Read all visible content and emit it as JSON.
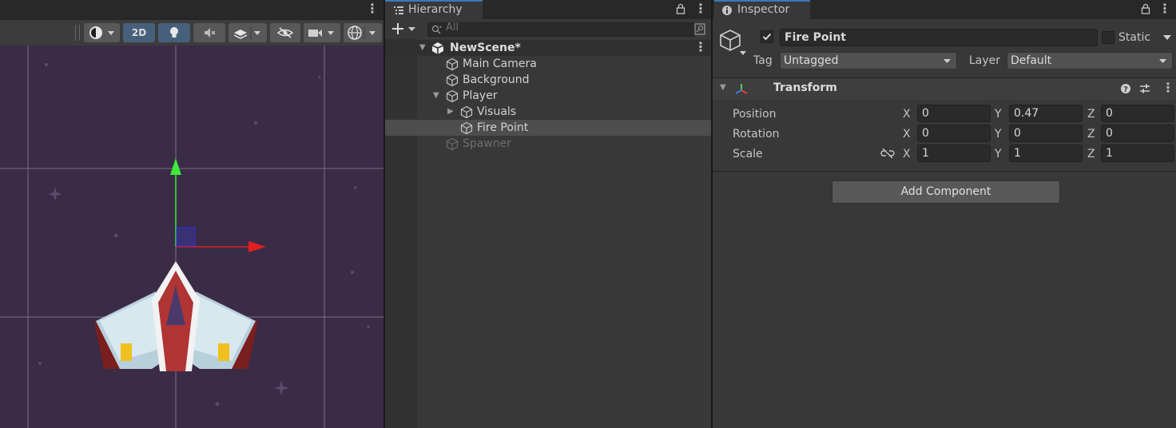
{
  "scene_view": {
    "toolbar": {
      "shading_icon": "circle-shading-icon",
      "mode_2d_label": "2D",
      "lighting_icon": "lightbulb-icon",
      "audio_icon": "audio-mute-icon",
      "effects_icon": "layers-icon",
      "visibility_icon": "eye-slash-icon",
      "camera_icon": "video-camera-icon",
      "gizmos_icon": "globe-gizmo-icon"
    },
    "colors": {
      "background": "#3a2b47",
      "accent_on": "#46607c",
      "y_axis": "#3ee83e",
      "x_axis": "#e02020"
    }
  },
  "hierarchy": {
    "tab_label": "Hierarchy",
    "search_placeholder": "All",
    "scene_name": "NewScene*",
    "items": [
      {
        "label": "Main Camera",
        "depth": 1,
        "selected": false,
        "inactive": false,
        "expandable": false
      },
      {
        "label": "Background",
        "depth": 1,
        "selected": false,
        "inactive": false,
        "expandable": false
      },
      {
        "label": "Player",
        "depth": 1,
        "selected": false,
        "inactive": false,
        "expandable": true,
        "expanded": true
      },
      {
        "label": "Visuals",
        "depth": 2,
        "selected": false,
        "inactive": false,
        "expandable": true,
        "expanded": false
      },
      {
        "label": "Fire Point",
        "depth": 2,
        "selected": true,
        "inactive": false,
        "expandable": false
      },
      {
        "label": "Spawner",
        "depth": 1,
        "selected": false,
        "inactive": true,
        "expandable": false
      }
    ]
  },
  "inspector": {
    "tab_label": "Inspector",
    "object_name": "Fire Point",
    "active": true,
    "static_label": "Static",
    "static_checked": false,
    "tag_label": "Tag",
    "tag_value": "Untagged",
    "layer_label": "Layer",
    "layer_value": "Default",
    "transform": {
      "title": "Transform",
      "position": {
        "label": "Position",
        "x": "0",
        "y": "0.47",
        "z": "0"
      },
      "rotation": {
        "label": "Rotation",
        "x": "0",
        "y": "0",
        "z": "0"
      },
      "scale": {
        "label": "Scale",
        "x": "1",
        "y": "1",
        "z": "1"
      }
    },
    "axis_labels": {
      "x": "X",
      "y": "Y",
      "z": "Z"
    },
    "add_component_label": "Add Component"
  }
}
